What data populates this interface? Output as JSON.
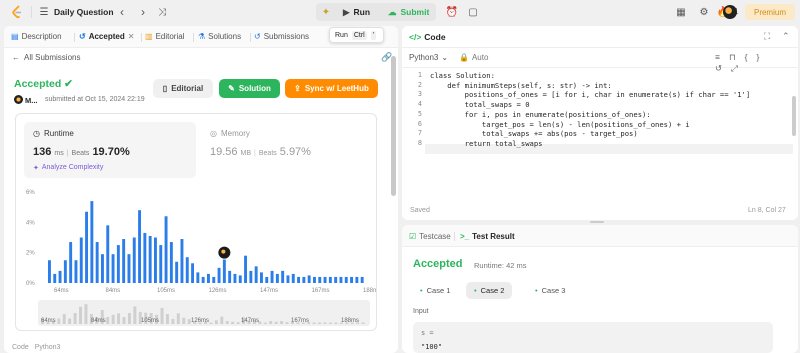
{
  "topbar": {
    "title": "Daily Question",
    "run_label": "Run",
    "submit_label": "Submit",
    "streak": "1",
    "premium_label": "Premium"
  },
  "tooltip": {
    "label": "Run",
    "shortcut": "Ctrl",
    "key": "'"
  },
  "left_tabs": {
    "description": "Description",
    "accepted": "Accepted",
    "editorial": "Editorial",
    "solutions": "Solutions",
    "submissions": "Submissions"
  },
  "submission": {
    "back_label": "All Submissions",
    "status": "Accepted",
    "user": "M...",
    "submitted_text": "submitted at Oct 15, 2024 22:19",
    "editorial_btn": "Editorial",
    "solution_btn": "Solution",
    "sync_btn": "Sync w/ LeetHub"
  },
  "stats": {
    "runtime_label": "Runtime",
    "runtime_value": "136",
    "runtime_unit": "ms",
    "beats_label": "Beats",
    "runtime_beats": "19.70%",
    "analyze_label": "Analyze Complexity",
    "memory_label": "Memory",
    "memory_value": "19.56",
    "memory_unit": "MB",
    "memory_beats": "5.97%"
  },
  "chart_data": {
    "type": "bar",
    "ylabels": [
      "6%",
      "4%",
      "2%",
      "0%"
    ],
    "ylim": [
      0,
      6
    ],
    "xlabels": [
      "64ms",
      "84ms",
      "105ms",
      "126ms",
      "147ms",
      "167ms",
      "188ms"
    ],
    "mini_xlabels": [
      "64ms",
      "84ms",
      "105ms",
      "126ms",
      "147ms",
      "167ms",
      "188ms"
    ],
    "values": [
      1.5,
      0.6,
      0.8,
      1.5,
      2.7,
      1.5,
      3.0,
      4.7,
      5.4,
      2.7,
      1.9,
      3.8,
      1.9,
      2.5,
      2.9,
      1.9,
      3.0,
      4.8,
      3.3,
      3.1,
      3.0,
      2.5,
      4.4,
      2.7,
      1.4,
      2.9,
      1.7,
      1.3,
      0.7,
      0.4,
      0.6,
      0.4,
      1.0,
      2.0,
      0.8,
      0.6,
      0.5,
      1.8,
      0.8,
      1.1,
      0.7,
      0.4,
      0.8,
      0.6,
      0.8,
      0.5,
      0.6,
      0.4,
      0.4,
      0.5,
      0.4,
      0.4,
      0.4,
      0.4,
      0.4,
      0.4,
      0.4,
      0.4,
      0.4,
      0.4
    ],
    "highlight_index": 33,
    "color": "#2b7de9"
  },
  "code_panel": {
    "title": "Code",
    "language": "Python3",
    "mode": "Auto",
    "status": "Saved",
    "cursor": "Ln 8, Col 27",
    "lines": [
      "class Solution:",
      "    def minimumSteps(self, s: str) -> int:",
      "        positions_of_ones = [i for i, char in enumerate(s) if char == '1']",
      "        total_swaps = 0",
      "        for i, pos in enumerate(positions_of_ones):",
      "            target_pos = len(s) - len(positions_of_ones) + i",
      "            total_swaps += abs(pos - target_pos)",
      "        return total_swaps"
    ],
    "line_numbers": [
      "1",
      "2",
      "3",
      "4",
      "5",
      "6",
      "7",
      "8"
    ]
  },
  "result_panel": {
    "testcase_tab": "Testcase",
    "result_tab": "Test Result",
    "status": "Accepted",
    "runtime": "Runtime: 42 ms",
    "cases": [
      "Case 1",
      "Case 2",
      "Case 3"
    ],
    "input_label": "Input",
    "var_name": "s =",
    "var_value": "\"100\""
  },
  "bottom_peek": {
    "code_label": "Code",
    "lang": "Python3"
  }
}
